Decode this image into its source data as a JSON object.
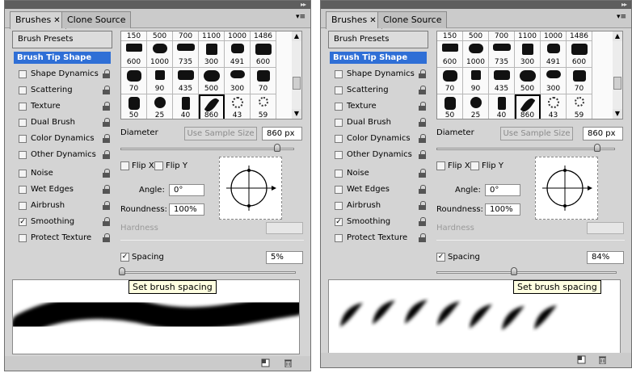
{
  "panels": [
    {
      "tabs": [
        {
          "label": "Brushes",
          "close": "✕"
        },
        {
          "label": "Clone Source"
        }
      ],
      "collapse": "▸▸",
      "menu": "▾≡",
      "brush_presets": "Brush Presets",
      "brush_tip_shape": "Brush Tip Shape",
      "options": [
        {
          "label": "Shape Dynamics",
          "checked": false,
          "lock": true
        },
        {
          "label": "Scattering",
          "checked": false,
          "lock": true
        },
        {
          "label": "Texture",
          "checked": false,
          "lock": true
        },
        {
          "label": "Dual Brush",
          "checked": false,
          "lock": true
        },
        {
          "label": "Color Dynamics",
          "checked": false,
          "lock": true
        },
        {
          "label": "Other Dynamics",
          "checked": false,
          "lock": true
        },
        {
          "label": "Noise",
          "checked": false,
          "lock": true
        },
        {
          "label": "Wet Edges",
          "checked": false,
          "lock": true
        },
        {
          "label": "Airbrush",
          "checked": false,
          "lock": true
        },
        {
          "label": "Smoothing",
          "checked": true,
          "lock": true
        },
        {
          "label": "Protect Texture",
          "checked": false,
          "lock": true
        }
      ],
      "brush_sizes": [
        [
          "150",
          "500",
          "700",
          "1100",
          "1000",
          "1486"
        ],
        [
          "600",
          "1000",
          "735",
          "300",
          "491",
          "600"
        ],
        [
          "70",
          "90",
          "435",
          "500",
          "300",
          "70"
        ],
        [
          "50",
          "25",
          "40",
          "860",
          "43",
          "59"
        ]
      ],
      "selected_brush": "860",
      "diameter_label": "Diameter",
      "use_sample_size": "Use Sample Size",
      "diameter_value": "860 px",
      "diameter_level": 0.9,
      "flip_x": "Flip X",
      "flip_y": "Flip Y",
      "angle_label": "Angle:",
      "angle_value": "0°",
      "roundness_label": "Roundness:",
      "roundness_value": "100%",
      "hardness_label": "Hardness",
      "spacing_label": "Spacing",
      "spacing_checked": true,
      "spacing_value": "5%",
      "spacing_level": 0.0,
      "tooltip": "Set brush spacing",
      "stroke_style": "continuous"
    },
    {
      "tabs": [
        {
          "label": "Brushes",
          "close": "✕"
        },
        {
          "label": "Clone Source"
        }
      ],
      "collapse": "▸▸",
      "menu": "▾≡",
      "brush_presets": "Brush Presets",
      "brush_tip_shape": "Brush Tip Shape",
      "options": [
        {
          "label": "Shape Dynamics",
          "checked": false,
          "lock": true
        },
        {
          "label": "Scattering",
          "checked": false,
          "lock": true
        },
        {
          "label": "Texture",
          "checked": false,
          "lock": true
        },
        {
          "label": "Dual Brush",
          "checked": false,
          "lock": true
        },
        {
          "label": "Color Dynamics",
          "checked": false,
          "lock": true
        },
        {
          "label": "Other Dynamics",
          "checked": false,
          "lock": true
        },
        {
          "label": "Noise",
          "checked": false,
          "lock": true
        },
        {
          "label": "Wet Edges",
          "checked": false,
          "lock": true
        },
        {
          "label": "Airbrush",
          "checked": false,
          "lock": true
        },
        {
          "label": "Smoothing",
          "checked": true,
          "lock": true
        },
        {
          "label": "Protect Texture",
          "checked": false,
          "lock": true
        }
      ],
      "brush_sizes": [
        [
          "150",
          "500",
          "700",
          "1100",
          "1000",
          "1486"
        ],
        [
          "600",
          "1000",
          "735",
          "300",
          "491",
          "600"
        ],
        [
          "70",
          "90",
          "435",
          "500",
          "300",
          "70"
        ],
        [
          "50",
          "25",
          "40",
          "860",
          "43",
          "59"
        ]
      ],
      "selected_brush": "860",
      "diameter_label": "Diameter",
      "use_sample_size": "Use Sample Size",
      "diameter_value": "860 px",
      "diameter_level": 0.9,
      "flip_x": "Flip X",
      "flip_y": "Flip Y",
      "angle_label": "Angle:",
      "angle_value": "0°",
      "roundness_label": "Roundness:",
      "roundness_value": "100%",
      "hardness_label": "Hardness",
      "spacing_label": "Spacing",
      "spacing_checked": true,
      "spacing_value": "84%",
      "spacing_level": 0.42,
      "tooltip": "Set brush spacing",
      "stroke_style": "dabs"
    }
  ],
  "colors": {
    "panel_bg": "#d4d4d4",
    "selection": "#2f6fd6",
    "tooltip_bg": "#ffffe1"
  }
}
